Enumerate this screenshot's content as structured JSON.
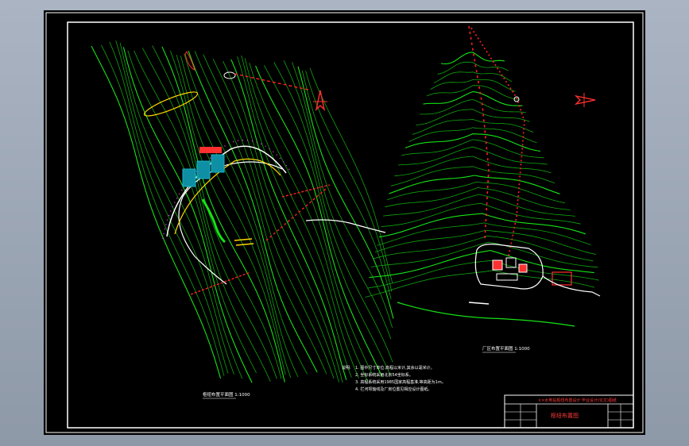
{
  "colors": {
    "background": "#000000",
    "frame": "#ffffff",
    "contour": "#16e316",
    "contour_dark": "#0fa60f",
    "survey": "#ff2020",
    "building": "#17b3c9",
    "road": "#ffffff",
    "accent_magenta": "#ff40ff",
    "title_block_text": "#ff3a3a"
  },
  "icons": {
    "north_arrow": "north-arrow-icon"
  },
  "notes": {
    "heading": "说明:",
    "lines": [
      "1. 图中尺寸单位:高程以米计,其余以毫米计。",
      "2. 坐标系统采用北京54坐标系。",
      "3. 高程系统采用1985国家高程基准,等高距为1m。",
      "4. 拦河坝轴线及厂房位置见相应设计图纸。"
    ]
  },
  "labels": {
    "left_plan": "枢纽布置平面图 1:1000",
    "right_plan": "厂区布置平面图 1:1000"
  },
  "title_block": {
    "header": "××水电站枢纽布置设计 毕业设计(论文)图纸",
    "drawing_name": "枢纽布置图"
  }
}
